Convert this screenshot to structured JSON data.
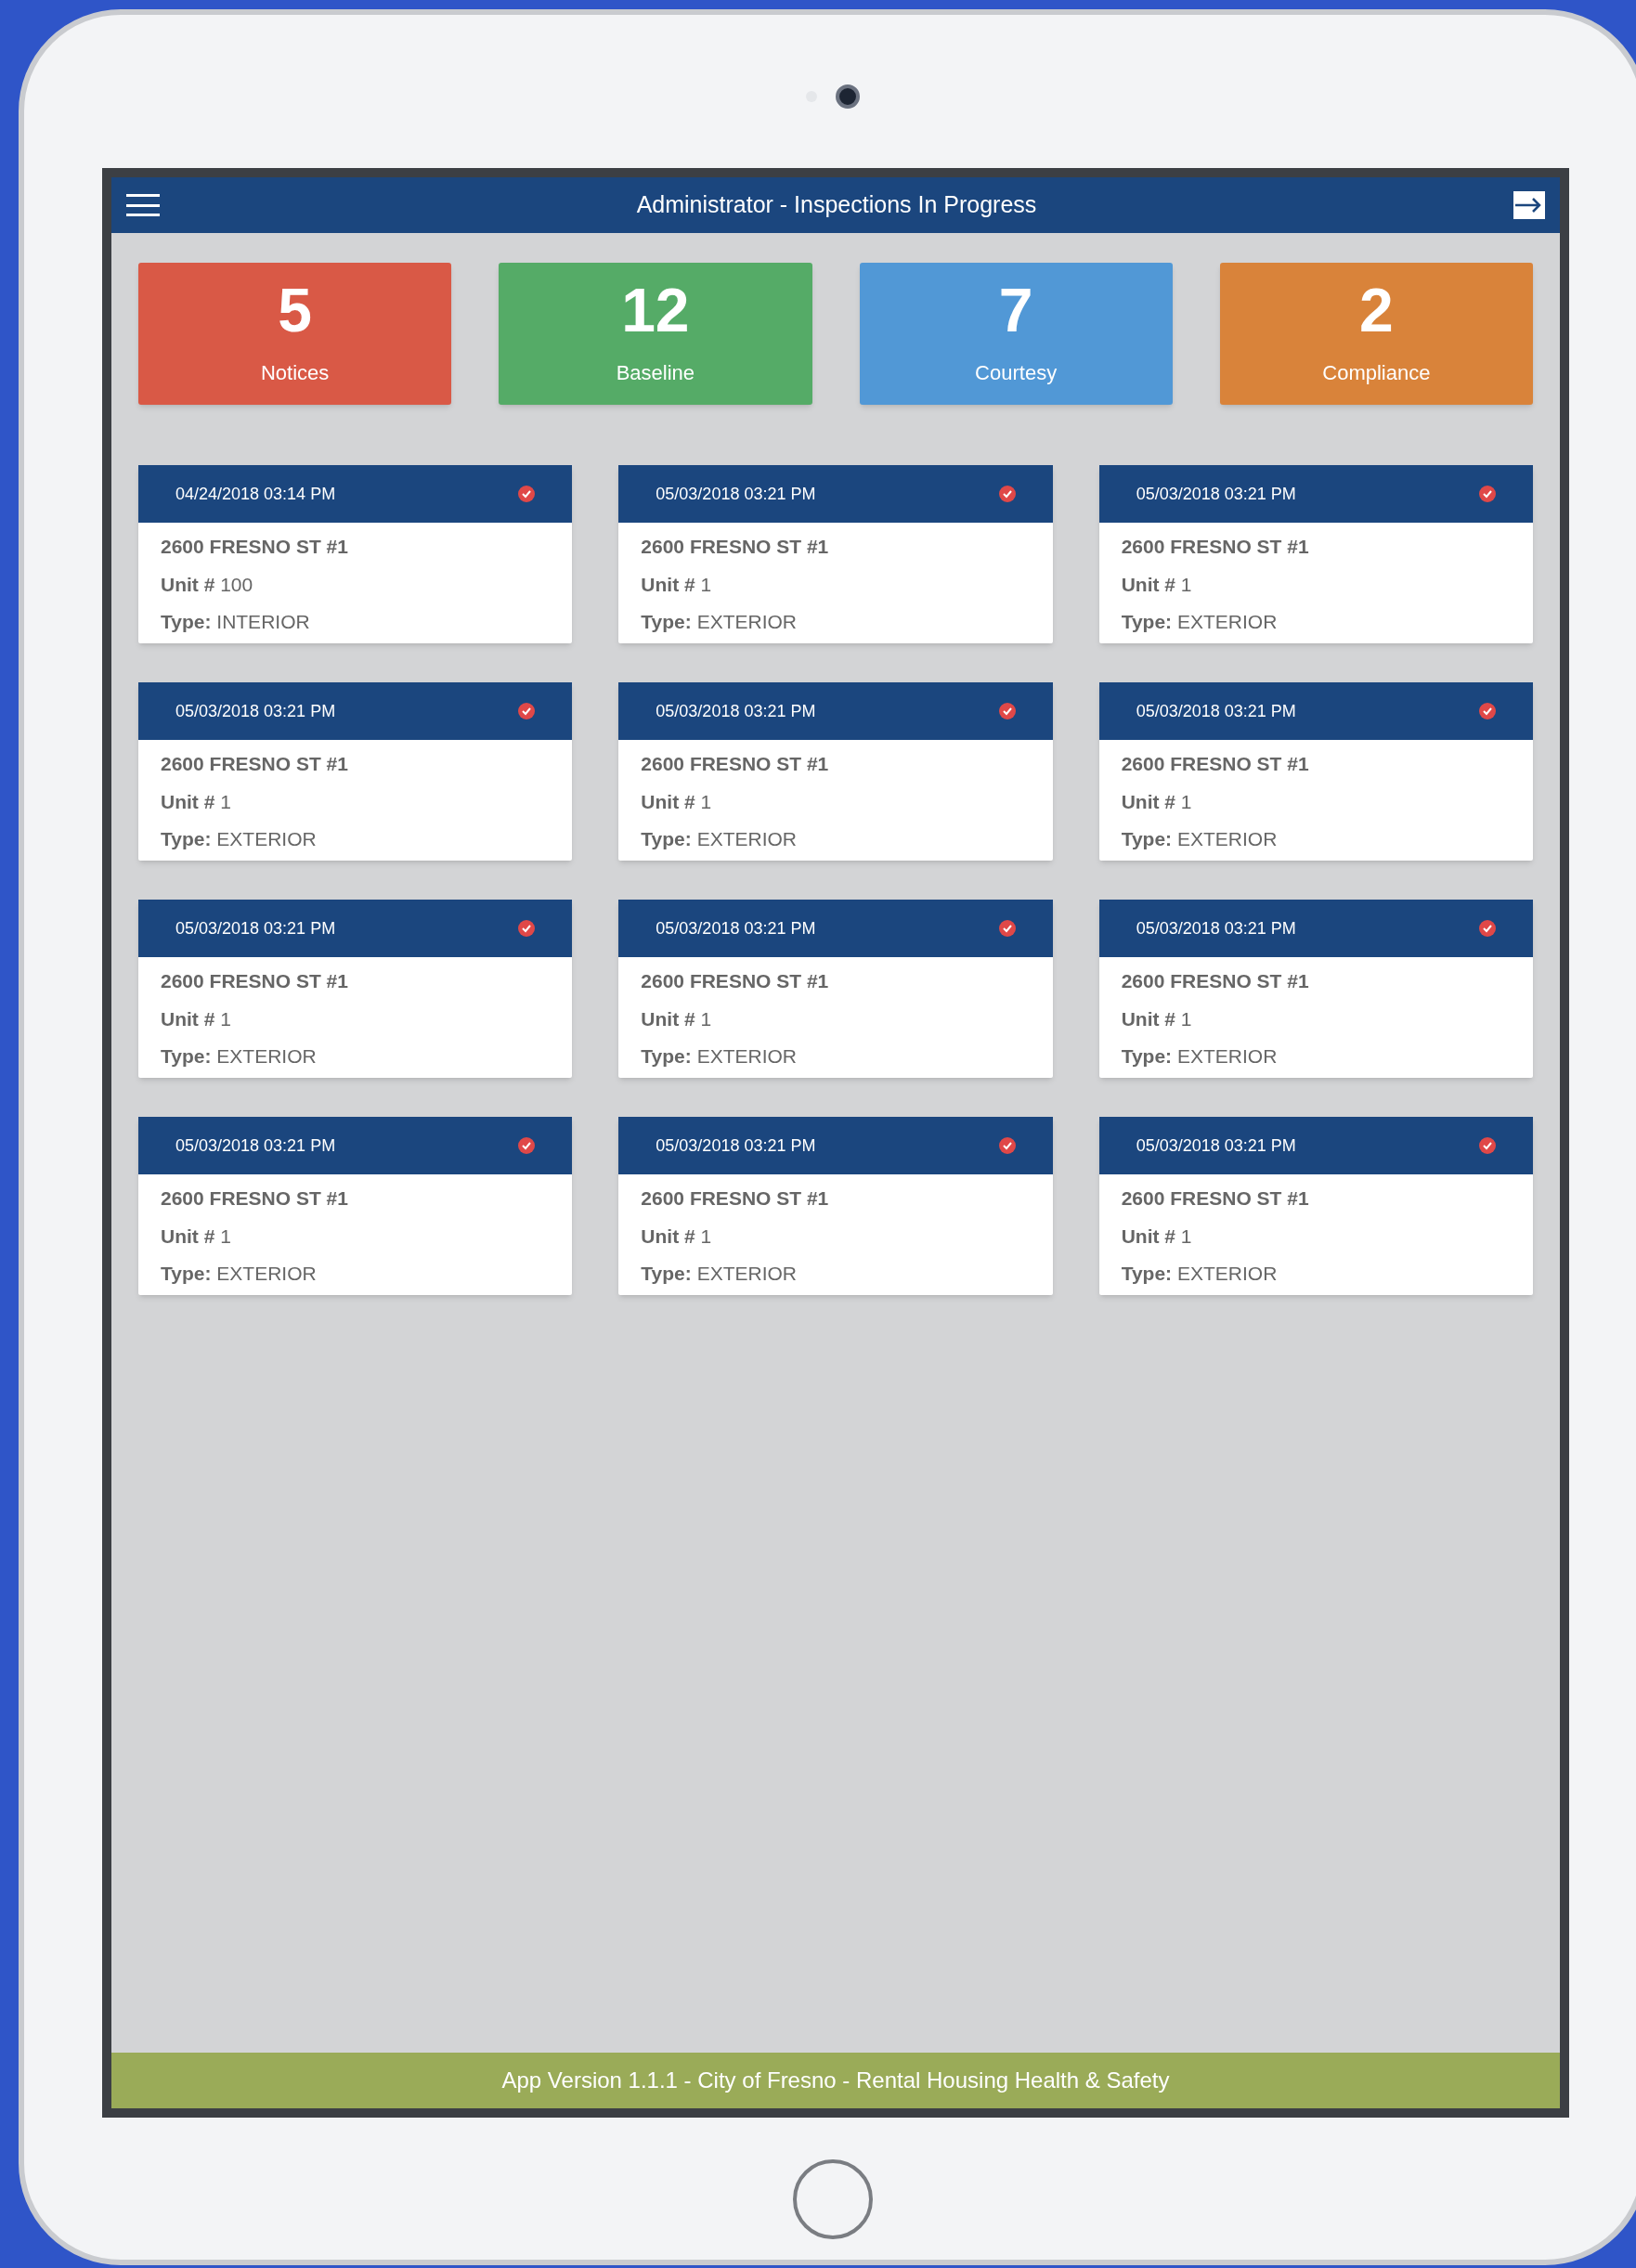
{
  "header": {
    "title": "Administrator - Inspections In Progress"
  },
  "stats": [
    {
      "value": "5",
      "label": "Notices",
      "color": "#d95946"
    },
    {
      "value": "12",
      "label": "Baseline",
      "color": "#55ab67"
    },
    {
      "value": "7",
      "label": "Courtesy",
      "color": "#5198d6"
    },
    {
      "value": "2",
      "label": "Compliance",
      "color": "#d9833a"
    }
  ],
  "inspections": [
    {
      "datetime": "04/24/2018 03:14 PM",
      "address": "2600 FRESNO ST #1",
      "unit_label": "Unit #",
      "unit": "100",
      "type_label": "Type:",
      "type": "INTERIOR"
    },
    {
      "datetime": "05/03/2018 03:21 PM",
      "address": "2600 FRESNO ST #1",
      "unit_label": "Unit #",
      "unit": "1",
      "type_label": "Type:",
      "type": "EXTERIOR"
    },
    {
      "datetime": "05/03/2018 03:21 PM",
      "address": "2600 FRESNO ST #1",
      "unit_label": "Unit #",
      "unit": "1",
      "type_label": "Type:",
      "type": "EXTERIOR"
    },
    {
      "datetime": "05/03/2018 03:21 PM",
      "address": "2600 FRESNO ST #1",
      "unit_label": "Unit #",
      "unit": "1",
      "type_label": "Type:",
      "type": "EXTERIOR"
    },
    {
      "datetime": "05/03/2018 03:21 PM",
      "address": "2600 FRESNO ST #1",
      "unit_label": "Unit #",
      "unit": "1",
      "type_label": "Type:",
      "type": "EXTERIOR"
    },
    {
      "datetime": "05/03/2018 03:21 PM",
      "address": "2600 FRESNO ST #1",
      "unit_label": "Unit #",
      "unit": "1",
      "type_label": "Type:",
      "type": "EXTERIOR"
    },
    {
      "datetime": "05/03/2018 03:21 PM",
      "address": "2600 FRESNO ST #1",
      "unit_label": "Unit #",
      "unit": "1",
      "type_label": "Type:",
      "type": "EXTERIOR"
    },
    {
      "datetime": "05/03/2018 03:21 PM",
      "address": "2600 FRESNO ST #1",
      "unit_label": "Unit #",
      "unit": "1",
      "type_label": "Type:",
      "type": "EXTERIOR"
    },
    {
      "datetime": "05/03/2018 03:21 PM",
      "address": "2600 FRESNO ST #1",
      "unit_label": "Unit #",
      "unit": "1",
      "type_label": "Type:",
      "type": "EXTERIOR"
    },
    {
      "datetime": "05/03/2018 03:21 PM",
      "address": "2600 FRESNO ST #1",
      "unit_label": "Unit #",
      "unit": "1",
      "type_label": "Type:",
      "type": "EXTERIOR"
    },
    {
      "datetime": "05/03/2018 03:21 PM",
      "address": "2600 FRESNO ST #1",
      "unit_label": "Unit #",
      "unit": "1",
      "type_label": "Type:",
      "type": "EXTERIOR"
    },
    {
      "datetime": "05/03/2018 03:21 PM",
      "address": "2600 FRESNO ST #1",
      "unit_label": "Unit #",
      "unit": "1",
      "type_label": "Type:",
      "type": "EXTERIOR"
    }
  ],
  "footer": {
    "text": "App Version 1.1.1 - City of Fresno - Rental Housing Health & Safety"
  }
}
